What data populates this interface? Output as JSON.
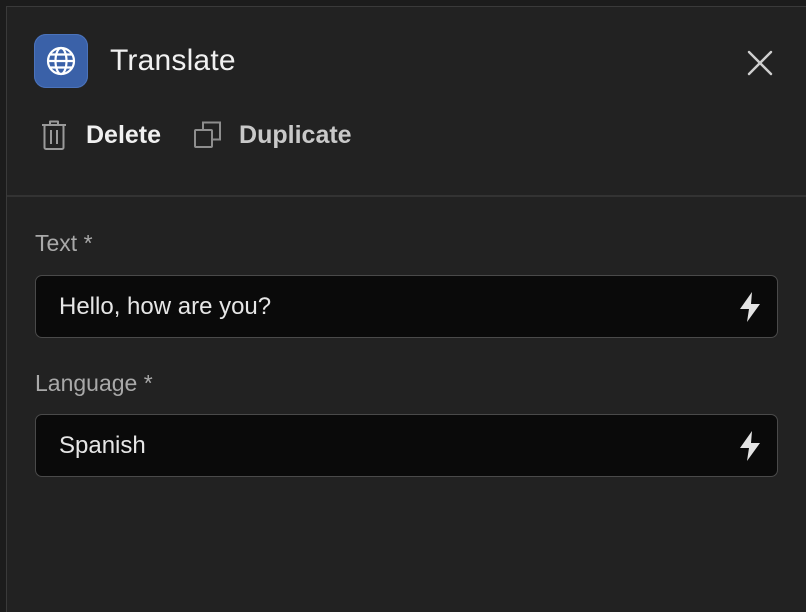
{
  "header": {
    "title": "Translate",
    "app_icon": "globe-icon",
    "accent_color": "#3a61a8",
    "close_icon": "close-icon"
  },
  "actions": {
    "delete_label": "Delete",
    "delete_icon": "trash-icon",
    "duplicate_label": "Duplicate",
    "duplicate_icon": "copy-icon"
  },
  "fields": [
    {
      "label": "Text *",
      "value": "Hello, how are you?",
      "icon": "lightning-icon"
    },
    {
      "label": "Language *",
      "value": "Spanish",
      "icon": "lightning-icon"
    }
  ]
}
